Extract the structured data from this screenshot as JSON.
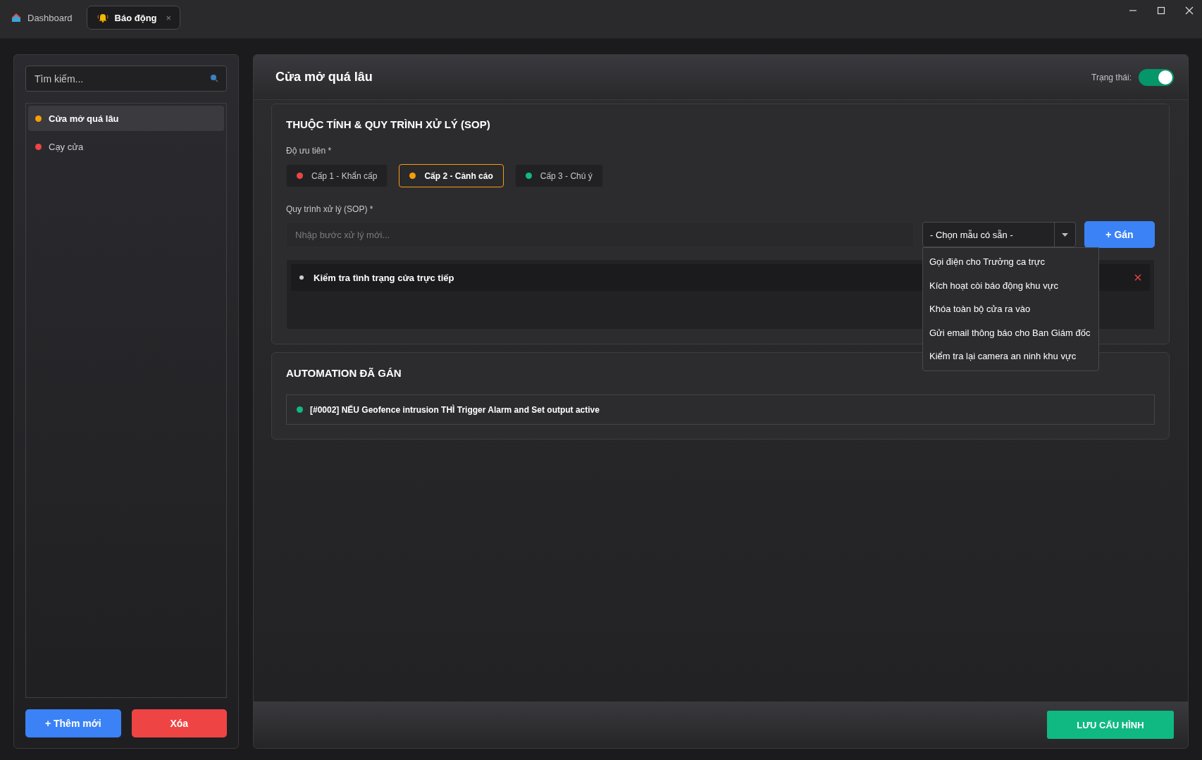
{
  "tabs": [
    {
      "label": "Dashboard",
      "kind": "home",
      "selected": false
    },
    {
      "label": "Báo động",
      "kind": "alarm",
      "selected": true,
      "close": "×"
    }
  ],
  "sidebar": {
    "search": {
      "placeholder": "Tìm kiếm..."
    },
    "items": [
      {
        "label": "Cửa mở quá lâu",
        "color": "#f59e0b",
        "selected": true
      },
      {
        "label": "Cạy cửa",
        "color": "#ef4444",
        "selected": false
      }
    ],
    "buttons": [
      {
        "label": "+ Thêm mới",
        "kind": "primary"
      },
      {
        "label": "Xóa",
        "kind": "danger"
      }
    ]
  },
  "detail": {
    "title": "Cửa mở quá lâu",
    "status_label": "Trạng thái:",
    "status_on": true
  },
  "sop_card": {
    "title": "THUỘC TÍNH & QUY TRÌNH XỬ LÝ (SOP)",
    "priority_label": "Độ ưu tiên *",
    "priorities": [
      {
        "label": "Cấp 1 - Khẩn cấp",
        "color": "#ef4444",
        "selected": false
      },
      {
        "label": "Cấp 2 - Cảnh cáo",
        "color": "#f59e0b",
        "selected": true
      },
      {
        "label": "Cấp 3 - Chú ý",
        "color": "#10b981",
        "selected": false
      }
    ],
    "sop_label": "Quy trình xử lý (SOP) *",
    "step_input": {
      "placeholder": "Nhập bước xử lý mới..."
    },
    "template_select": {
      "value": "- Chọn mẫu có sẵn -",
      "expanded": true,
      "options": [
        "Gọi điện cho Trưởng ca trực",
        "Kích hoạt còi báo động khu vực",
        "Khóa toàn bộ cửa ra vào",
        "Gửi email thông báo cho Ban Giám đốc",
        "Kiểm tra lại camera an ninh khu vực"
      ]
    },
    "assign_button": "+ Gán",
    "steps": [
      {
        "text": "Kiểm tra tình trạng cửa trực tiếp"
      }
    ]
  },
  "automation_card": {
    "title": "AUTOMATION ĐÃ GÁN",
    "items": [
      {
        "text": "[#0002] NẾU Geofence intrusion THÌ Trigger Alarm and Set output active",
        "color": "#10b981"
      }
    ]
  },
  "save_button": "LƯU CẤU HÌNH"
}
